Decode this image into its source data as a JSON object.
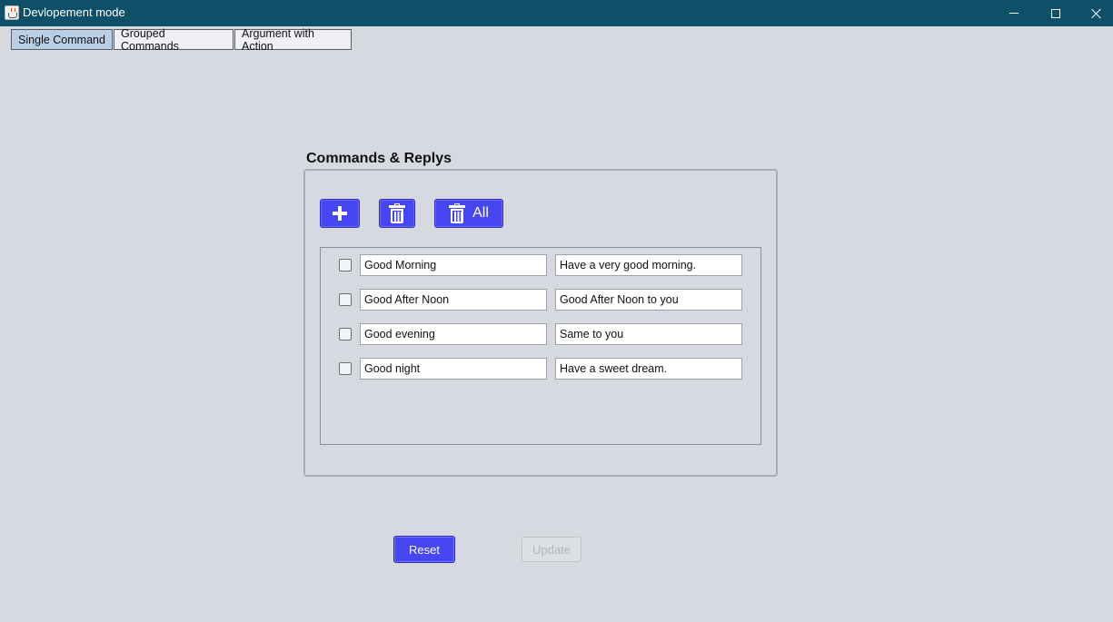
{
  "window": {
    "title": "Devlopement mode",
    "app_icon": "java-cup-icon",
    "controls": [
      "minimize-icon",
      "maximize-icon",
      "close-icon"
    ]
  },
  "tabs": [
    {
      "label": "Single Command",
      "active": true
    },
    {
      "label": "Grouped Commands",
      "active": false
    },
    {
      "label": "Argument with Action",
      "active": false
    }
  ],
  "panel": {
    "title": "Commands & Replys",
    "toolbar": {
      "add_icon": "plus-icon",
      "delete_icon": "trash-icon",
      "delete_all_label": "All"
    },
    "rows": [
      {
        "checked": false,
        "command": "Good Morning",
        "reply": "Have a very good morning."
      },
      {
        "checked": false,
        "command": "Good After Noon",
        "reply": "Good After Noon to you"
      },
      {
        "checked": false,
        "command": "Good evening",
        "reply": "Same to you"
      },
      {
        "checked": false,
        "command": "Good night",
        "reply": "Have a sweet dream."
      }
    ]
  },
  "actions": {
    "reset_label": "Reset",
    "update_label": "Update",
    "update_enabled": false
  },
  "colors": {
    "titlebar": "#0e5068",
    "accent_button": "#4646f5",
    "background": "#d6d9e0",
    "active_tab": "#b8cfe5"
  }
}
